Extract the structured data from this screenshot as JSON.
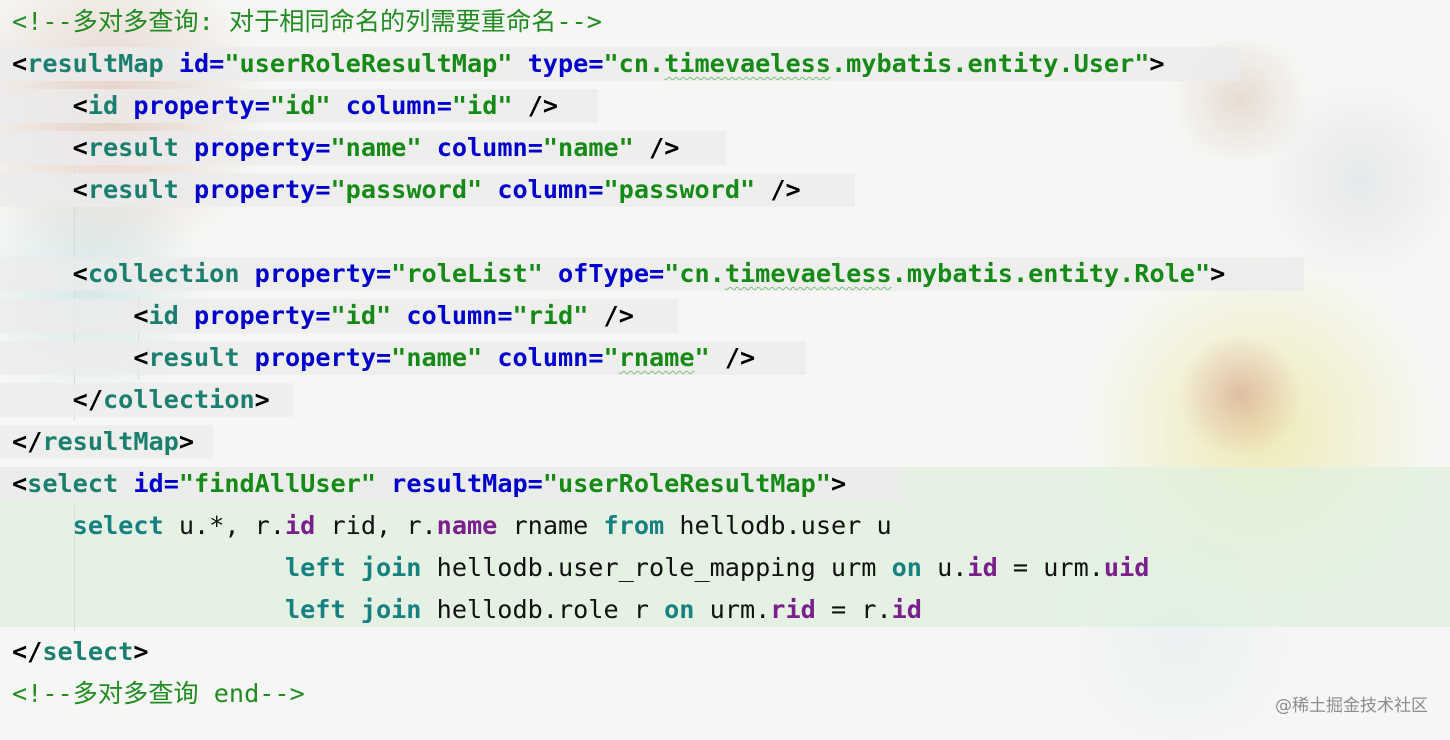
{
  "editor": {
    "lines": [
      {
        "tokens": [
          {
            "t": "<!--多对多查询: 对于相同命名的列需要重命名-->",
            "c": "cm"
          }
        ]
      },
      {
        "tokens": [
          {
            "t": "<",
            "c": "pun"
          },
          {
            "t": "resultMap",
            "c": "tag"
          },
          {
            "t": " ",
            "c": "txt"
          },
          {
            "t": "id",
            "c": "attr"
          },
          {
            "t": "=",
            "c": "attr"
          },
          {
            "t": "\"userRoleResultMap\"",
            "c": "str"
          },
          {
            "t": " ",
            "c": "txt"
          },
          {
            "t": "type",
            "c": "attr"
          },
          {
            "t": "=",
            "c": "attr"
          },
          {
            "t": "\"cn.timevaeless.mybatis.entity.User\"",
            "c": "str"
          },
          {
            "t": ">",
            "c": "pun"
          }
        ]
      },
      {
        "tokens": [
          {
            "t": "    ",
            "c": "txt"
          },
          {
            "t": "<",
            "c": "pun"
          },
          {
            "t": "id",
            "c": "tag"
          },
          {
            "t": " ",
            "c": "txt"
          },
          {
            "t": "property",
            "c": "attr"
          },
          {
            "t": "=",
            "c": "attr"
          },
          {
            "t": "\"id\"",
            "c": "str"
          },
          {
            "t": " ",
            "c": "txt"
          },
          {
            "t": "column",
            "c": "attr"
          },
          {
            "t": "=",
            "c": "attr"
          },
          {
            "t": "\"id\"",
            "c": "str"
          },
          {
            "t": " />",
            "c": "pun"
          }
        ]
      },
      {
        "tokens": [
          {
            "t": "    ",
            "c": "txt"
          },
          {
            "t": "<",
            "c": "pun"
          },
          {
            "t": "result",
            "c": "tag"
          },
          {
            "t": " ",
            "c": "txt"
          },
          {
            "t": "property",
            "c": "attr"
          },
          {
            "t": "=",
            "c": "attr"
          },
          {
            "t": "\"name\"",
            "c": "str"
          },
          {
            "t": " ",
            "c": "txt"
          },
          {
            "t": "column",
            "c": "attr"
          },
          {
            "t": "=",
            "c": "attr"
          },
          {
            "t": "\"name\"",
            "c": "str"
          },
          {
            "t": " />",
            "c": "pun"
          }
        ]
      },
      {
        "tokens": [
          {
            "t": "    ",
            "c": "txt"
          },
          {
            "t": "<",
            "c": "pun"
          },
          {
            "t": "result",
            "c": "tag"
          },
          {
            "t": " ",
            "c": "txt"
          },
          {
            "t": "property",
            "c": "attr"
          },
          {
            "t": "=",
            "c": "attr"
          },
          {
            "t": "\"password\"",
            "c": "str"
          },
          {
            "t": " ",
            "c": "txt"
          },
          {
            "t": "column",
            "c": "attr"
          },
          {
            "t": "=",
            "c": "attr"
          },
          {
            "t": "\"password\"",
            "c": "str"
          },
          {
            "t": " />",
            "c": "pun"
          }
        ]
      },
      {
        "tokens": []
      },
      {
        "tokens": [
          {
            "t": "    ",
            "c": "txt"
          },
          {
            "t": "<",
            "c": "pun"
          },
          {
            "t": "collection",
            "c": "tag"
          },
          {
            "t": " ",
            "c": "txt"
          },
          {
            "t": "property",
            "c": "attr"
          },
          {
            "t": "=",
            "c": "attr"
          },
          {
            "t": "\"roleList\"",
            "c": "str"
          },
          {
            "t": " ",
            "c": "txt"
          },
          {
            "t": "ofType",
            "c": "attr"
          },
          {
            "t": "=",
            "c": "attr"
          },
          {
            "t": "\"cn.timevaeless.mybatis.entity.Role\"",
            "c": "str"
          },
          {
            "t": ">",
            "c": "pun"
          }
        ]
      },
      {
        "tokens": [
          {
            "t": "        ",
            "c": "txt"
          },
          {
            "t": "<",
            "c": "pun"
          },
          {
            "t": "id",
            "c": "tag"
          },
          {
            "t": " ",
            "c": "txt"
          },
          {
            "t": "property",
            "c": "attr"
          },
          {
            "t": "=",
            "c": "attr"
          },
          {
            "t": "\"id\"",
            "c": "str"
          },
          {
            "t": " ",
            "c": "txt"
          },
          {
            "t": "column",
            "c": "attr"
          },
          {
            "t": "=",
            "c": "attr"
          },
          {
            "t": "\"rid\"",
            "c": "str"
          },
          {
            "t": " />",
            "c": "pun"
          }
        ]
      },
      {
        "tokens": [
          {
            "t": "        ",
            "c": "txt"
          },
          {
            "t": "<",
            "c": "pun"
          },
          {
            "t": "result",
            "c": "tag"
          },
          {
            "t": " ",
            "c": "txt"
          },
          {
            "t": "property",
            "c": "attr"
          },
          {
            "t": "=",
            "c": "attr"
          },
          {
            "t": "\"name\"",
            "c": "str"
          },
          {
            "t": " ",
            "c": "txt"
          },
          {
            "t": "column",
            "c": "attr"
          },
          {
            "t": "=",
            "c": "attr"
          },
          {
            "t": "\"rname\"",
            "c": "str"
          },
          {
            "t": " />",
            "c": "pun"
          }
        ]
      },
      {
        "tokens": [
          {
            "t": "    ",
            "c": "txt"
          },
          {
            "t": "</",
            "c": "pun"
          },
          {
            "t": "collection",
            "c": "tag"
          },
          {
            "t": ">",
            "c": "pun"
          }
        ]
      },
      {
        "tokens": [
          {
            "t": "</",
            "c": "pun"
          },
          {
            "t": "resultMap",
            "c": "tag"
          },
          {
            "t": ">",
            "c": "pun"
          }
        ]
      },
      {
        "tokens": [
          {
            "t": "<",
            "c": "pun"
          },
          {
            "t": "select",
            "c": "tag"
          },
          {
            "t": " ",
            "c": "txt"
          },
          {
            "t": "id",
            "c": "attr"
          },
          {
            "t": "=",
            "c": "attr"
          },
          {
            "t": "\"findAllUser\"",
            "c": "str"
          },
          {
            "t": " ",
            "c": "txt"
          },
          {
            "t": "resultMap",
            "c": "attr"
          },
          {
            "t": "=",
            "c": "attr"
          },
          {
            "t": "\"userRoleResultMap\"",
            "c": "str"
          },
          {
            "t": ">",
            "c": "pun"
          }
        ]
      },
      {
        "tokens": [
          {
            "t": "    ",
            "c": "txt"
          },
          {
            "t": "select",
            "c": "kw"
          },
          {
            "t": " u.*, r.",
            "c": "txt"
          },
          {
            "t": "id",
            "c": "fld"
          },
          {
            "t": " rid, r.",
            "c": "txt"
          },
          {
            "t": "name",
            "c": "fld"
          },
          {
            "t": " rname ",
            "c": "txt"
          },
          {
            "t": "from",
            "c": "kw"
          },
          {
            "t": " hellodb.user u",
            "c": "txt"
          }
        ]
      },
      {
        "tokens": [
          {
            "t": "                  ",
            "c": "txt"
          },
          {
            "t": "left",
            "c": "kw"
          },
          {
            "t": " ",
            "c": "txt"
          },
          {
            "t": "join",
            "c": "kw"
          },
          {
            "t": " hellodb.user_role_mapping urm ",
            "c": "txt"
          },
          {
            "t": "on",
            "c": "kw"
          },
          {
            "t": " u.",
            "c": "txt"
          },
          {
            "t": "id",
            "c": "fld"
          },
          {
            "t": " = urm.",
            "c": "txt"
          },
          {
            "t": "uid",
            "c": "fld"
          }
        ]
      },
      {
        "tokens": [
          {
            "t": "                  ",
            "c": "txt"
          },
          {
            "t": "left",
            "c": "kw"
          },
          {
            "t": " ",
            "c": "txt"
          },
          {
            "t": "join",
            "c": "kw"
          },
          {
            "t": " hellodb.role r ",
            "c": "txt"
          },
          {
            "t": "on",
            "c": "kw"
          },
          {
            "t": " urm.",
            "c": "txt"
          },
          {
            "t": "rid",
            "c": "fld"
          },
          {
            "t": " = r.",
            "c": "txt"
          },
          {
            "t": "id",
            "c": "fld"
          }
        ]
      },
      {
        "tokens": [
          {
            "t": "</",
            "c": "pun"
          },
          {
            "t": "select",
            "c": "tag"
          },
          {
            "t": ">",
            "c": "pun"
          }
        ]
      },
      {
        "tokens": [
          {
            "t": "<!--多对多查询 end-->",
            "c": "cm"
          }
        ]
      }
    ]
  },
  "watermark": "@稀土掘金技术社区"
}
